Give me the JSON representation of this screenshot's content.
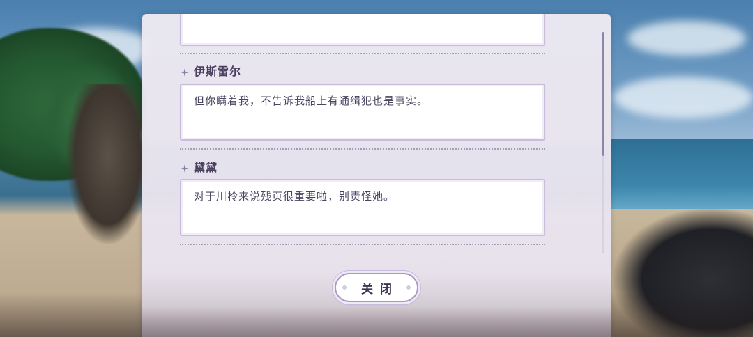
{
  "dialog_log": {
    "entries": [
      {
        "speaker": "",
        "text": ""
      },
      {
        "speaker": "伊斯雷尔",
        "text": "但你瞒着我，不告诉我船上有通缉犯也是事实。"
      },
      {
        "speaker": "黛黛",
        "text": "对于川柃来说残页很重要啦，别责怪她。"
      }
    ]
  },
  "close_button": {
    "label": "关闭"
  },
  "colors": {
    "panel_bg": "#ece8f1",
    "box_border": "#c9bddb",
    "name_text": "#4a3e5e",
    "body_text": "#4a4460",
    "scroll_thumb": "#8f85a6"
  },
  "icons": {
    "speaker_marker": "sparkle-icon"
  },
  "scroll": {
    "position_fraction": 0.56
  }
}
